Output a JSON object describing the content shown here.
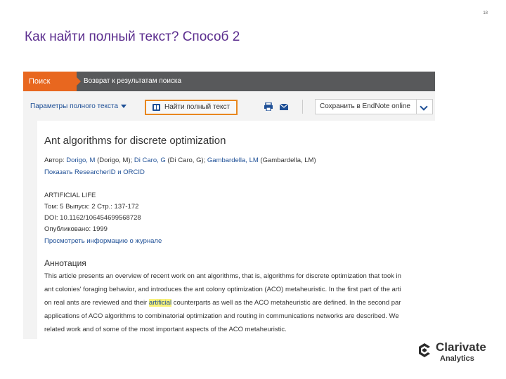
{
  "slide": {
    "number": "18",
    "title": "Как найти полный текст? Способ 2"
  },
  "topbar": {
    "search_tab": "Поиск",
    "back_link": "Возврат к результатам поиска"
  },
  "toolbar": {
    "fulltext_options": "Параметры полного текста",
    "find_fulltext": "Найти полный текст",
    "save_endnote": "Сохранить в EndNote online"
  },
  "article": {
    "title": "Ant algorithms for discrete optimization",
    "author_label": "Автор:",
    "authors": [
      {
        "name": "Dorigo, M",
        "full": "(Dorigo, M);"
      },
      {
        "name": "Di Caro, G",
        "full": "(Di Caro, G);"
      },
      {
        "name": "Gambardella, LM",
        "full": "(Gambardella, LM)"
      }
    ],
    "researcher_link": "Показать ResearcherID и ORCID",
    "journal": "ARTIFICIAL LIFE",
    "volume_line": "Том:  5  Выпуск:  2  Стр.:  137-172",
    "doi_line": "DOI:  10.1162/106454699568728",
    "published_line": "Опубликовано:  1999",
    "journal_link": "Просмотреть информацию о журнале",
    "abstract_heading": "Аннотация",
    "abstract_lines": [
      "This article presents an overview of recent work on ant algorithms, that is, algorithms for discrete optimization that took in",
      "ant colonies' foraging behavior, and introduces the ant colony optimization (ACO) metaheuristic. In the first part of the arti",
      "counterparts as well as the ACO metaheuristic are defined. In the second par",
      "applications of ACO algorithms to combinatorial optimization and routing in communications networks are described. We",
      "related work and of some of the most important aspects of the ACO metaheuristic."
    ],
    "abstract_line3_prefix": "on real ants are reviewed and their",
    "abstract_highlight": "artificial"
  },
  "logo": {
    "name": "Clarivate",
    "sub": "Analytics"
  },
  "colors": {
    "title": "#5b2d8e",
    "accent": "#e8671f",
    "link": "#1e4f96",
    "highlight": "#f9f27a"
  }
}
